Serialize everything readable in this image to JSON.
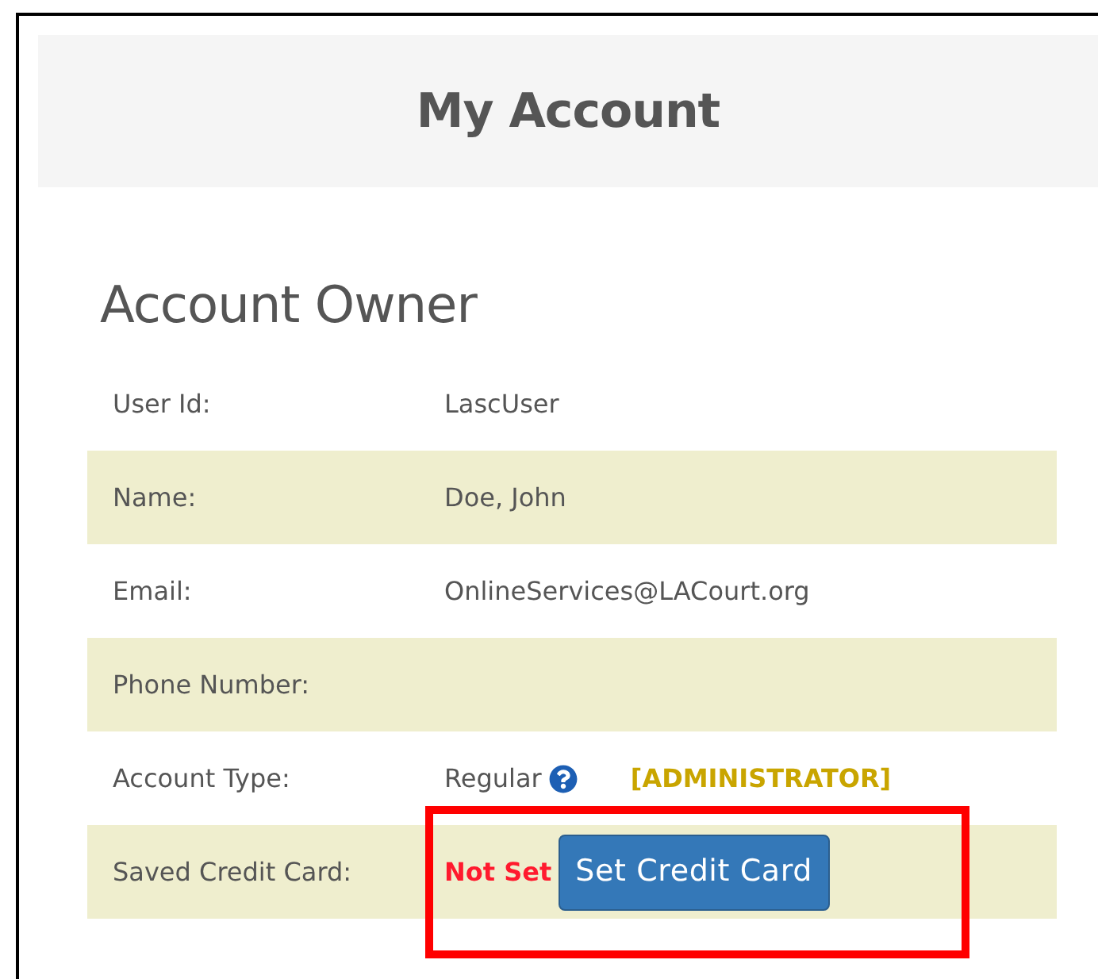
{
  "page": {
    "title": "My Account"
  },
  "section": {
    "heading": "Account Owner",
    "rows": [
      {
        "kind": "text",
        "label": "User Id:",
        "value": "LascUser",
        "highlighted": false
      },
      {
        "kind": "text",
        "label": "Name:",
        "value": "Doe, John",
        "highlighted": false
      },
      {
        "kind": "text",
        "label": "Email:",
        "value": "OnlineServices@LACourt.org",
        "highlighted": false
      },
      {
        "kind": "text",
        "label": "Phone Number:",
        "highlighted": false
      },
      {
        "kind": "account_type",
        "label": "Account Type:",
        "value": "Regular",
        "role": "[ADMINISTRATOR]",
        "highlighted": false
      },
      {
        "kind": "credit_card",
        "label": "Saved Credit Card:",
        "status": "Not Set",
        "button": "Set Credit Card",
        "highlighted": true
      }
    ]
  }
}
